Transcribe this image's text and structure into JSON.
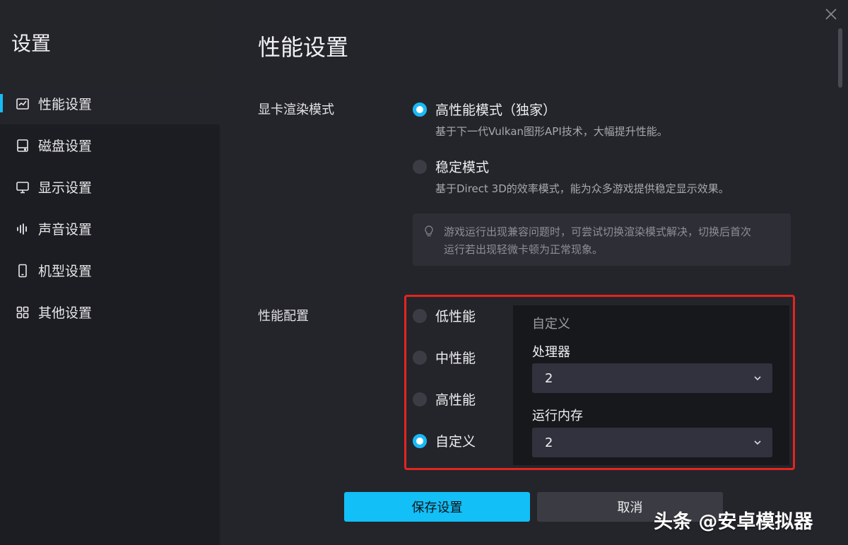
{
  "sidebar": {
    "title": "设置",
    "items": [
      {
        "label": "性能设置",
        "icon": "performance-chart-icon",
        "active": true
      },
      {
        "label": "磁盘设置",
        "icon": "disk-icon"
      },
      {
        "label": "显示设置",
        "icon": "monitor-icon"
      },
      {
        "label": "声音设置",
        "icon": "sound-wave-icon"
      },
      {
        "label": "机型设置",
        "icon": "phone-icon"
      },
      {
        "label": "其他设置",
        "icon": "grid-icon"
      }
    ]
  },
  "main": {
    "title": "性能设置",
    "render": {
      "label": "显卡渲染模式",
      "options": [
        {
          "label": "高性能模式（独家）",
          "desc": "基于下一代Vulkan图形API技术，大幅提升性能。",
          "checked": true
        },
        {
          "label": "稳定模式",
          "desc": "基于Direct 3D的效率模式，能为众多游戏提供稳定显示效果。",
          "checked": false
        }
      ],
      "tip_line1": "游戏运行出现兼容问题时，可尝试切换渲染模式解决，切换后首次",
      "tip_line2": "运行若出现轻微卡顿为正常现象。"
    },
    "perf": {
      "label": "性能配置",
      "options": [
        {
          "label": "低性能",
          "checked": false
        },
        {
          "label": "中性能",
          "checked": false
        },
        {
          "label": "高性能",
          "checked": false
        },
        {
          "label": "自定义",
          "checked": true
        }
      ],
      "custom": {
        "title": "自定义",
        "cpu_label": "处理器",
        "cpu_value": "2",
        "ram_label": "运行内存",
        "ram_value": "2"
      }
    },
    "save_label": "保存设置",
    "cancel_label": "取消"
  },
  "watermark": "头条 @安卓模拟器",
  "colors": {
    "accent": "#19b9f5",
    "highlight": "#e3251f",
    "background": "#24252b",
    "sidebar": "#1c1d22"
  }
}
